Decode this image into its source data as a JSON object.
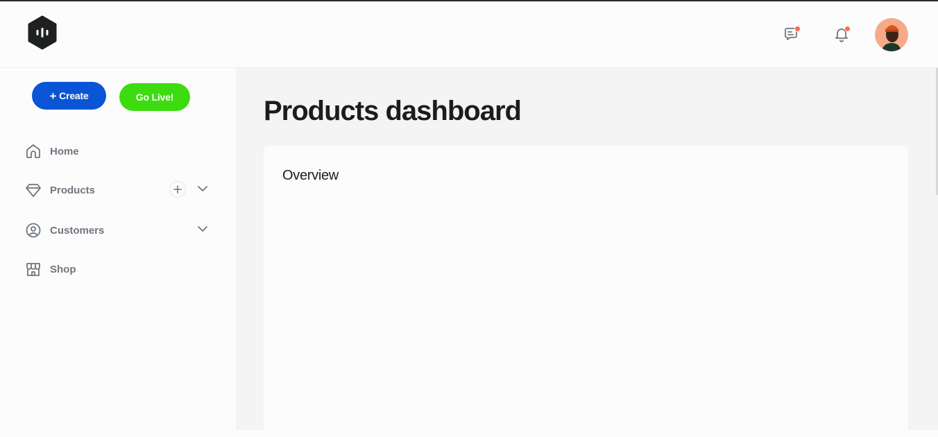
{
  "header": {
    "logo_icon": "hexagon-logo-icon",
    "messages_icon": "message-icon",
    "notifications_icon": "bell-icon",
    "notification_dot_color": "#ff6a55",
    "avatar": "user-avatar"
  },
  "sidebar": {
    "create_button": {
      "plus": "+",
      "label": "Create",
      "color": "#0a54d6"
    },
    "live_button": {
      "label": "Go Live!",
      "color": "#3ddc11"
    },
    "items": [
      {
        "label": "Home",
        "icon": "home-icon"
      },
      {
        "label": "Products",
        "icon": "diamond-icon",
        "has_add": true,
        "has_chevron": true
      },
      {
        "label": "Customers",
        "icon": "user-circle-icon",
        "has_chevron": true
      },
      {
        "label": "Shop",
        "icon": "store-icon"
      }
    ]
  },
  "main": {
    "title": "Products dashboard",
    "card": {
      "title": "Overview"
    }
  }
}
